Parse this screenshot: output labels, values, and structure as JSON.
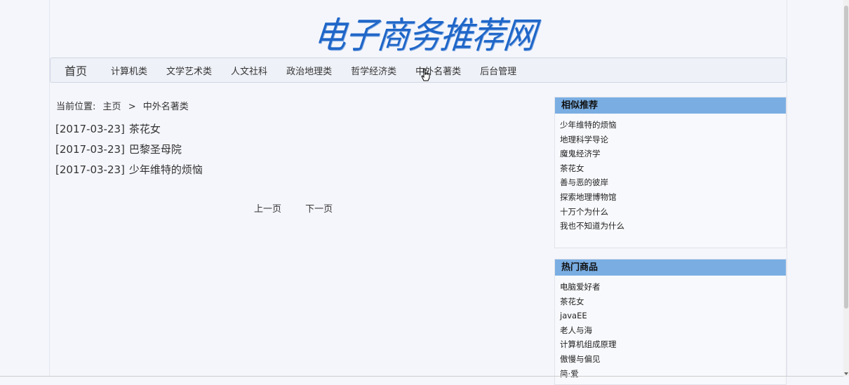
{
  "logo": {
    "text": "电子商务推荐网"
  },
  "nav": {
    "home": "首页",
    "items": [
      "计算机类",
      "文学艺术类",
      "人文社科",
      "政治地理类",
      "哲学经济类",
      "中外名著类",
      "后台管理"
    ]
  },
  "breadcrumb": {
    "label": "当前位置:",
    "home": "主页",
    "sep": ">",
    "current": "中外名著类"
  },
  "list": [
    {
      "date": "[2017-03-23]",
      "title": "茶花女"
    },
    {
      "date": "[2017-03-23]",
      "title": "巴黎圣母院"
    },
    {
      "date": "[2017-03-23]",
      "title": "少年维特的烦恼"
    }
  ],
  "pager": {
    "prev": "上一页",
    "next": "下一页"
  },
  "related": {
    "title": "相似推荐",
    "items": [
      "少年维特的烦恼",
      "地理科学导论",
      "魔鬼经济学",
      "茶花女",
      "善与恶的彼岸",
      "探索地理博物馆",
      "十万个为什么",
      "我也不知道为什么"
    ]
  },
  "hot": {
    "title": "热门商品",
    "items": [
      "电脑爱好者",
      "茶花女",
      "javaEE",
      "老人与海",
      "计算机组成原理",
      "傲慢与偏见",
      "简·爱"
    ]
  },
  "colors": {
    "panel_header": "#7aaee3",
    "logo": "#1f66c8"
  }
}
